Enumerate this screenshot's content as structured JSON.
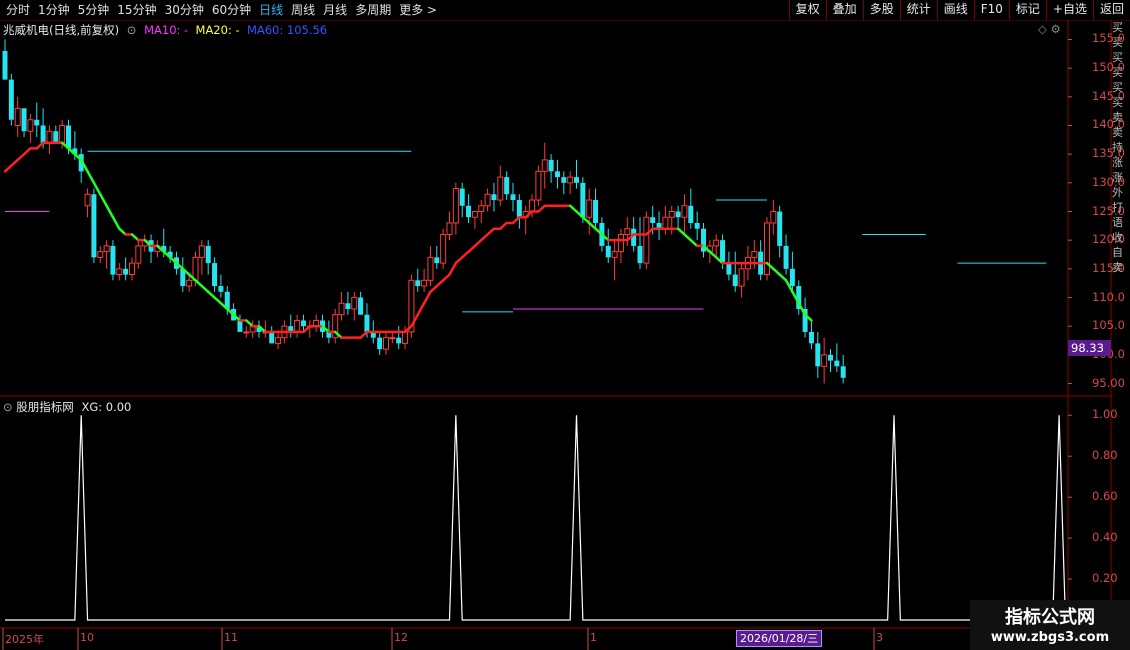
{
  "toolbar": {
    "periods": [
      "分时",
      "1分钟",
      "5分钟",
      "15分钟",
      "30分钟",
      "60分钟",
      "日线",
      "周线",
      "月线",
      "多周期",
      "更多 >"
    ],
    "active_period": "日线",
    "actions": [
      "复权",
      "叠加",
      "多股",
      "统计",
      "画线",
      "F10",
      "标记",
      "+自选",
      "返回"
    ]
  },
  "header": {
    "stock_name": "兆威机电(日线,前复权)",
    "ma10": "MA10: -",
    "ma20": "MA20: -",
    "ma60": "MA60: 105.56"
  },
  "subchart_header": {
    "name": "股朋指标网",
    "value": "XG: 0.00"
  },
  "price_axis": [
    "155.0",
    "150.0",
    "145.0",
    "140.0",
    "135.0",
    "130.0",
    "125.0",
    "120.0",
    "115.0",
    "110.0",
    "105.0",
    "100.0",
    "95.00"
  ],
  "current_price": "98.33",
  "sub_axis": [
    "1.00",
    "0.80",
    "0.60",
    "0.40",
    "0.20"
  ],
  "date_axis": [
    "2025年",
    "10",
    "11",
    "12",
    "1",
    "3"
  ],
  "selected_date": "2026/01/28/三",
  "right_strip_text": "买买买买买买卖卖持涨涨外打 语收自卖",
  "watermark": {
    "line1": "指标公式网",
    "line2": "www.zbgs3.com"
  },
  "colors": {
    "up": "#ff3b3b",
    "down": "#26e3f0",
    "ma_up": "#ff2020",
    "ma_down": "#22ff22",
    "ma10": "#ff33ff",
    "ma20": "#ffff44",
    "ma60": "#3355ff",
    "axis": "#d24a4a",
    "highlight": "#5a1b8f"
  },
  "chart_data": {
    "type": "candlestick",
    "price_range": [
      93,
      157
    ],
    "candles_ohlc": [
      [
        153,
        155,
        148,
        148
      ],
      [
        148,
        149,
        140,
        141
      ],
      [
        140,
        145,
        138,
        143
      ],
      [
        143,
        143,
        138,
        139
      ],
      [
        139,
        142,
        137,
        141
      ],
      [
        141,
        144,
        138,
        140
      ],
      [
        140,
        143,
        136,
        137
      ],
      [
        137,
        140,
        135,
        139
      ],
      [
        139,
        140,
        137,
        137
      ],
      [
        137,
        141,
        136,
        140
      ],
      [
        140,
        141,
        135,
        136
      ],
      [
        136,
        139,
        134,
        135
      ],
      [
        135,
        136,
        130,
        132
      ],
      [
        126,
        129,
        124,
        128
      ],
      [
        128,
        129,
        116,
        117
      ],
      [
        117,
        119,
        116,
        118
      ],
      [
        118,
        120,
        115,
        119
      ],
      [
        119,
        120,
        113,
        114
      ],
      [
        114,
        116,
        113,
        115
      ],
      [
        115,
        117,
        113,
        114
      ],
      [
        114,
        117,
        113,
        116
      ],
      [
        116,
        120,
        115,
        119
      ],
      [
        119,
        121,
        118,
        120
      ],
      [
        120,
        121,
        116,
        118
      ],
      [
        118,
        120,
        117,
        119
      ],
      [
        119,
        122,
        117,
        118
      ],
      [
        118,
        119,
        116,
        117
      ],
      [
        117,
        118,
        114,
        115
      ],
      [
        115,
        117,
        111,
        112
      ],
      [
        112,
        114,
        111,
        113
      ],
      [
        113,
        118,
        112,
        117
      ],
      [
        117,
        120,
        114,
        119
      ],
      [
        119,
        120,
        114,
        116
      ],
      [
        116,
        117,
        111,
        112
      ],
      [
        112,
        114,
        110,
        111
      ],
      [
        111,
        112,
        107,
        108
      ],
      [
        108,
        109,
        106,
        106
      ],
      [
        106,
        107,
        104,
        104
      ],
      [
        104,
        105,
        103,
        104
      ],
      [
        104,
        106,
        103,
        105
      ],
      [
        105,
        106,
        103,
        104
      ],
      [
        104,
        106,
        103,
        104
      ],
      [
        104,
        105,
        102,
        102
      ],
      [
        102,
        104,
        101,
        103
      ],
      [
        103,
        106,
        102,
        105
      ],
      [
        105,
        107,
        103,
        104
      ],
      [
        104,
        107,
        103,
        106
      ],
      [
        106,
        107,
        104,
        105
      ],
      [
        105,
        106,
        103,
        105
      ],
      [
        105,
        107,
        104,
        106
      ],
      [
        106,
        107,
        103,
        104
      ],
      [
        104,
        106,
        102,
        103
      ],
      [
        103,
        108,
        102,
        107
      ],
      [
        107,
        111,
        106,
        109
      ],
      [
        109,
        111,
        107,
        108
      ],
      [
        108,
        111,
        106,
        110
      ],
      [
        110,
        111,
        107,
        107
      ],
      [
        107,
        109,
        103,
        104
      ],
      [
        104,
        106,
        102,
        103
      ],
      [
        103,
        104,
        100,
        101
      ],
      [
        101,
        104,
        100,
        103
      ],
      [
        103,
        104,
        102,
        103
      ],
      [
        103,
        105,
        101,
        102
      ],
      [
        102,
        105,
        101,
        104
      ],
      [
        104,
        114,
        103,
        113
      ],
      [
        113,
        115,
        111,
        112
      ],
      [
        112,
        115,
        111,
        113
      ],
      [
        113,
        119,
        112,
        117
      ],
      [
        117,
        119,
        115,
        116
      ],
      [
        116,
        122,
        115,
        121
      ],
      [
        121,
        125,
        120,
        123
      ],
      [
        123,
        130,
        121,
        129
      ],
      [
        129,
        130,
        124,
        126
      ],
      [
        126,
        128,
        123,
        124
      ],
      [
        124,
        125,
        122,
        125
      ],
      [
        125,
        127,
        123,
        126
      ],
      [
        126,
        129,
        125,
        128
      ],
      [
        128,
        130,
        125,
        127
      ],
      [
        127,
        133,
        126,
        131
      ],
      [
        131,
        132,
        127,
        128
      ],
      [
        128,
        130,
        125,
        127
      ],
      [
        127,
        128,
        122,
        124
      ],
      [
        124,
        126,
        121,
        125
      ],
      [
        125,
        128,
        124,
        127
      ],
      [
        127,
        133,
        126,
        132
      ],
      [
        132,
        137,
        129,
        134
      ],
      [
        134,
        135,
        130,
        132
      ],
      [
        132,
        134,
        129,
        131
      ],
      [
        131,
        132,
        128,
        130
      ],
      [
        130,
        132,
        128,
        131
      ],
      [
        131,
        134,
        129,
        130
      ],
      [
        130,
        131,
        123,
        124
      ],
      [
        124,
        129,
        121,
        127
      ],
      [
        127,
        129,
        122,
        123
      ],
      [
        123,
        124,
        118,
        119
      ],
      [
        119,
        122,
        116,
        117
      ],
      [
        117,
        120,
        113,
        118
      ],
      [
        118,
        122,
        116,
        121
      ],
      [
        121,
        124,
        119,
        122
      ],
      [
        122,
        124,
        118,
        119
      ],
      [
        119,
        124,
        115,
        116
      ],
      [
        116,
        125,
        115,
        124
      ],
      [
        124,
        126,
        121,
        123
      ],
      [
        123,
        125,
        120,
        122
      ],
      [
        122,
        126,
        121,
        124
      ],
      [
        124,
        126,
        121,
        125
      ],
      [
        125,
        126,
        122,
        124
      ],
      [
        124,
        128,
        121,
        126
      ],
      [
        126,
        129,
        122,
        123
      ],
      [
        123,
        125,
        120,
        122
      ],
      [
        122,
        123,
        117,
        118
      ],
      [
        118,
        120,
        116,
        119
      ],
      [
        119,
        121,
        117,
        120
      ],
      [
        120,
        121,
        115,
        116
      ],
      [
        116,
        118,
        113,
        114
      ],
      [
        114,
        118,
        111,
        112
      ],
      [
        112,
        116,
        110,
        115
      ],
      [
        115,
        119,
        113,
        117
      ],
      [
        117,
        120,
        115,
        118
      ],
      [
        118,
        120,
        113,
        114
      ],
      [
        114,
        124,
        113,
        123
      ],
      [
        123,
        127,
        121,
        125
      ],
      [
        125,
        126,
        117,
        119
      ],
      [
        119,
        121,
        114,
        115
      ],
      [
        115,
        118,
        111,
        112
      ],
      [
        112,
        113,
        107,
        108
      ],
      [
        108,
        110,
        103,
        104
      ],
      [
        104,
        106,
        101,
        102
      ],
      [
        102,
        104,
        96,
        98
      ],
      [
        98,
        103,
        95,
        100
      ],
      [
        100,
        101,
        97,
        99
      ],
      [
        99,
        102,
        97,
        98
      ],
      [
        98,
        100,
        95,
        96
      ]
    ],
    "ma_line": [
      132,
      133,
      134,
      135,
      136,
      136,
      137,
      137,
      137,
      137,
      136,
      135,
      134,
      132,
      130,
      128,
      126,
      124,
      122,
      121,
      121,
      120,
      120,
      119,
      119,
      118,
      117,
      116,
      115,
      114,
      113,
      112,
      111,
      110,
      109,
      108,
      107,
      106,
      106,
      105,
      105,
      104,
      104,
      104,
      104,
      104,
      104,
      104,
      105,
      105,
      105,
      104,
      104,
      103,
      103,
      103,
      103,
      104,
      104,
      104,
      104,
      104,
      104,
      104,
      105,
      107,
      109,
      111,
      112,
      113,
      114,
      116,
      117,
      118,
      119,
      120,
      121,
      122,
      122,
      123,
      123,
      124,
      124,
      125,
      125,
      126,
      126,
      126,
      126,
      126,
      125,
      124,
      123,
      122,
      121,
      120,
      120,
      120,
      120,
      121,
      121,
      121,
      122,
      122,
      122,
      122,
      122,
      121,
      120,
      119,
      119,
      118,
      117,
      116,
      116,
      116,
      116,
      116,
      116,
      116,
      116,
      115,
      114,
      113,
      111,
      109,
      107,
      106
    ],
    "pivot_lines": [
      {
        "price": 135.5,
        "color": "#26e3f0"
      },
      {
        "price": 125.0,
        "color": "#ff33ff"
      },
      {
        "price": 107.5,
        "color": "#26e3f0"
      },
      {
        "price": 108.0,
        "color": "#ff33ff"
      },
      {
        "price": 127.0,
        "color": "#26e3f0"
      },
      {
        "price": 121.0,
        "color": "#26e3f0"
      },
      {
        "price": 116.0,
        "color": "#26e3f0"
      }
    ],
    "xg_signal_spikes": [
      12,
      71,
      90,
      140,
      166
    ],
    "xg_range": [
      0,
      1.05
    ]
  }
}
